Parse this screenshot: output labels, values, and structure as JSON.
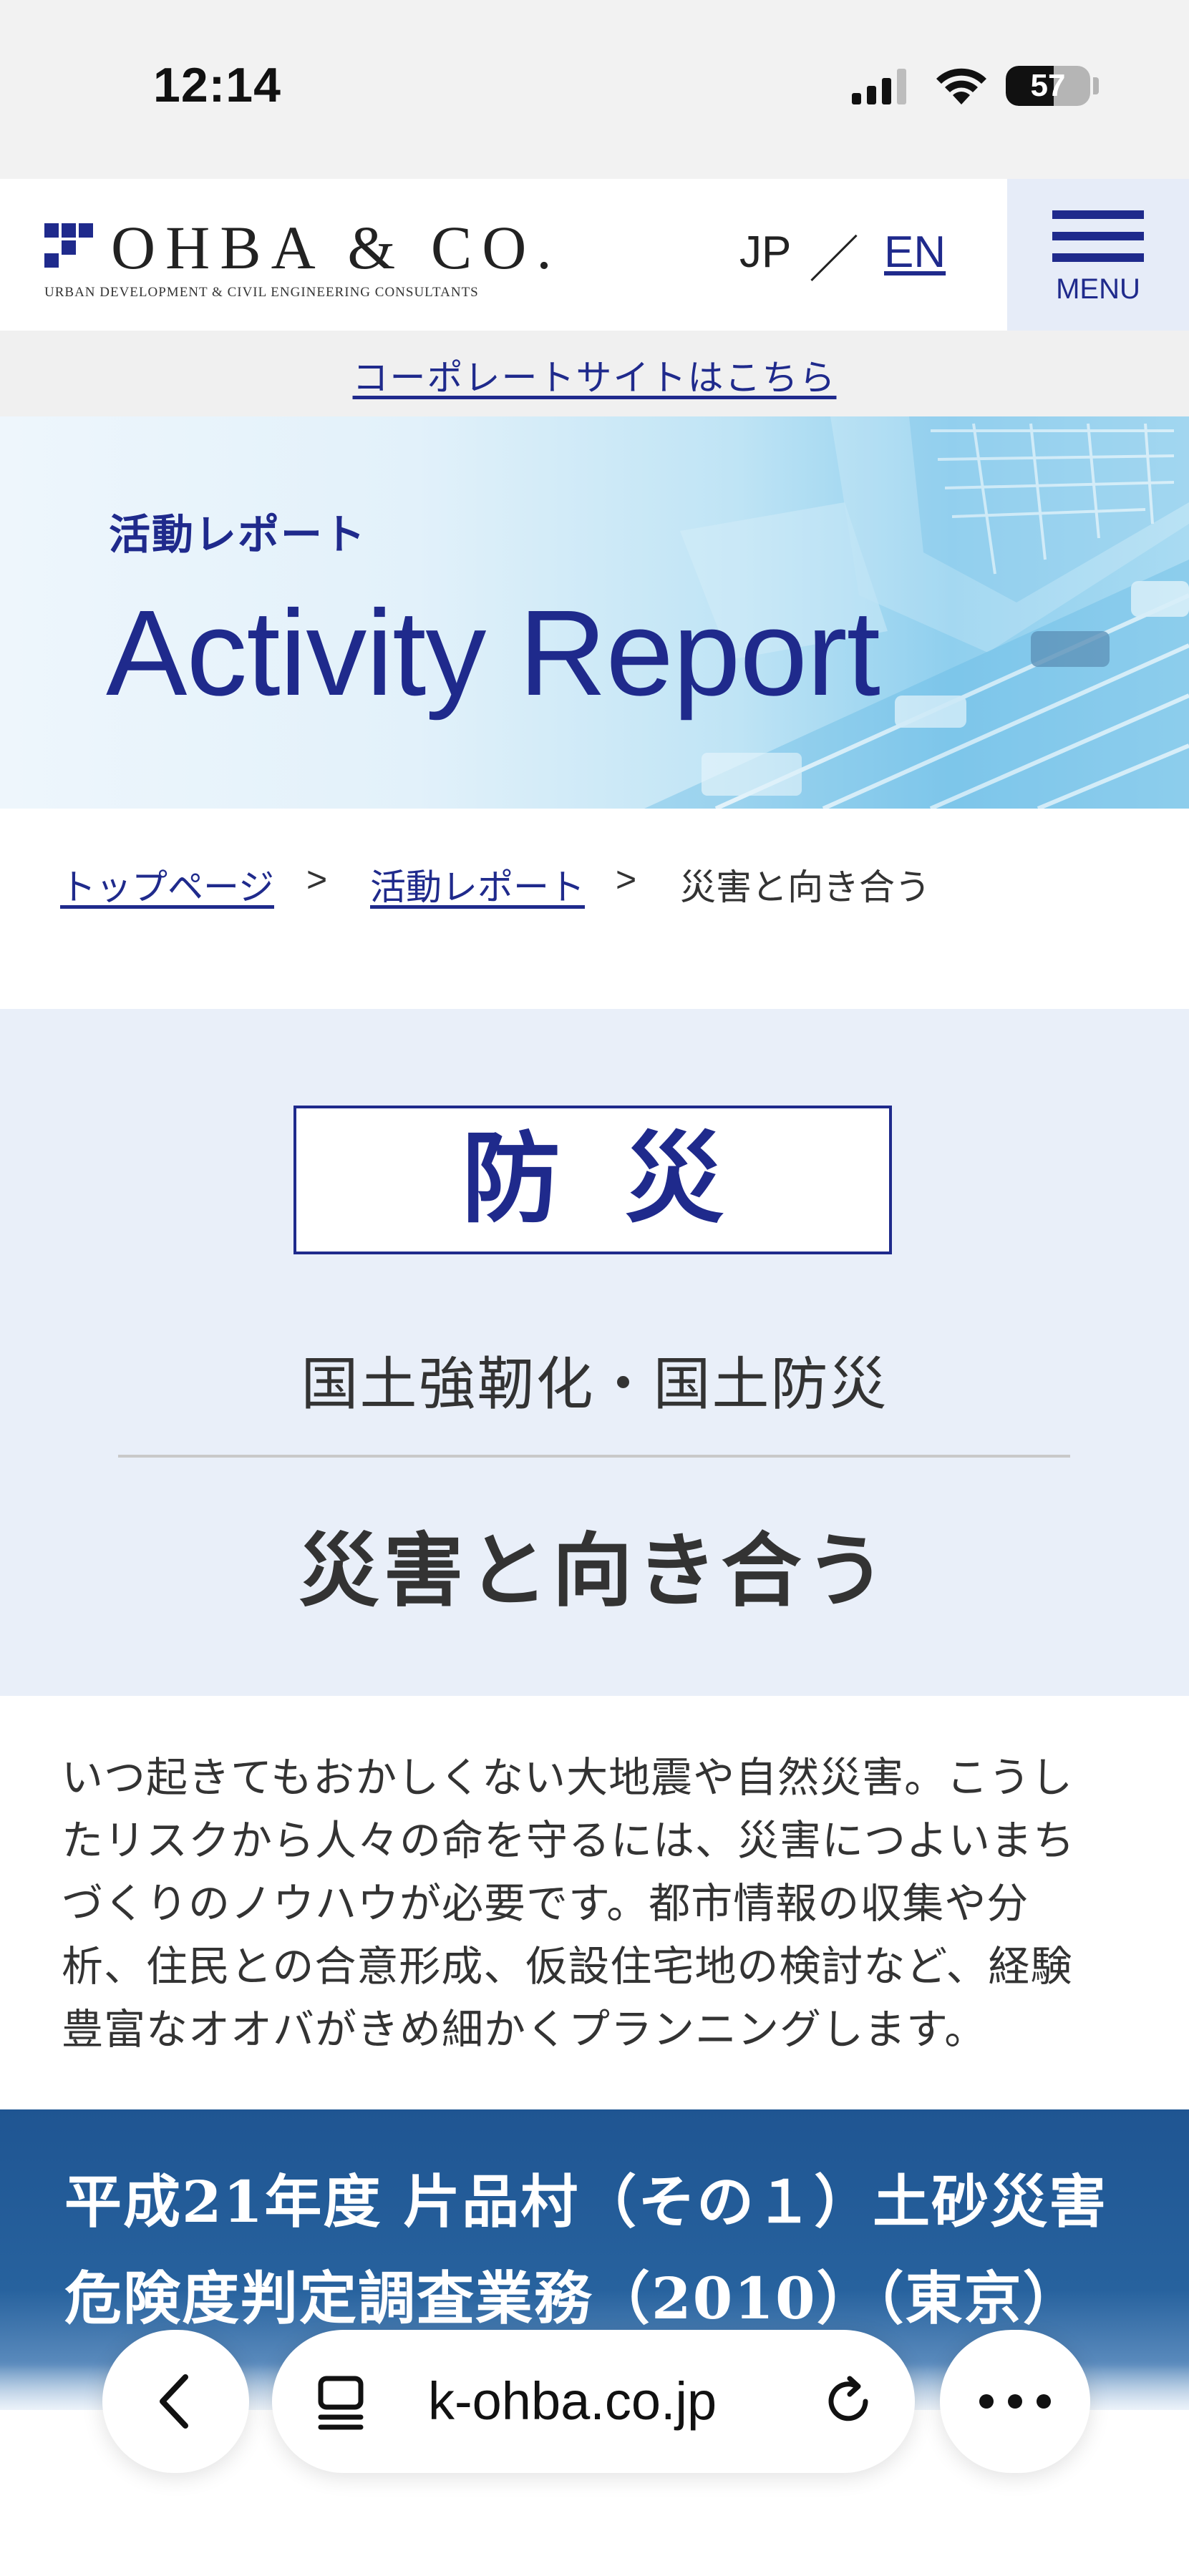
{
  "status_bar": {
    "time": "12:14",
    "battery_level": "57"
  },
  "header": {
    "logo_text": "OHBA & CO.",
    "logo_subtitle": "URBAN DEVELOPMENT & CIVIL ENGINEERING CONSULTANTS",
    "lang_jp": "JP",
    "lang_separator": "／",
    "lang_en": "EN",
    "menu_label": "MENU"
  },
  "corporate_link": "コーポレートサイトはこちら",
  "hero": {
    "subtitle": "活動レポート",
    "title": "Activity Report"
  },
  "breadcrumb": {
    "items": [
      "トップページ",
      "活動レポート",
      "災害と向き合う"
    ],
    "separator": ">"
  },
  "article": {
    "category": "防災",
    "sub_category": "国土強靭化・国土防災",
    "title": "災害と向き合う",
    "body_lines": [
      "いつ起きてもおかしくない大地震や自然災害。こうし",
      "たリスクから人々の命を守るには、災害につよいまち",
      "づくりのノウハウが必要です。都市情報の収集や分",
      "析、住民との合意形成、仮設住宅地の検討など、経験",
      "豊富なオオバがきめ細かくプランニングします。"
    ],
    "project_title_lines": [
      "平成21年度 片品村（その１）土砂災害",
      "危険度判定調査業務（2010）（東京）"
    ]
  },
  "browser": {
    "url": "k-ohba.co.jp"
  },
  "colors": {
    "brand_navy": "#1f2a8c",
    "section_bg": "#e9eff9",
    "banner_blue": "#1f5592"
  }
}
